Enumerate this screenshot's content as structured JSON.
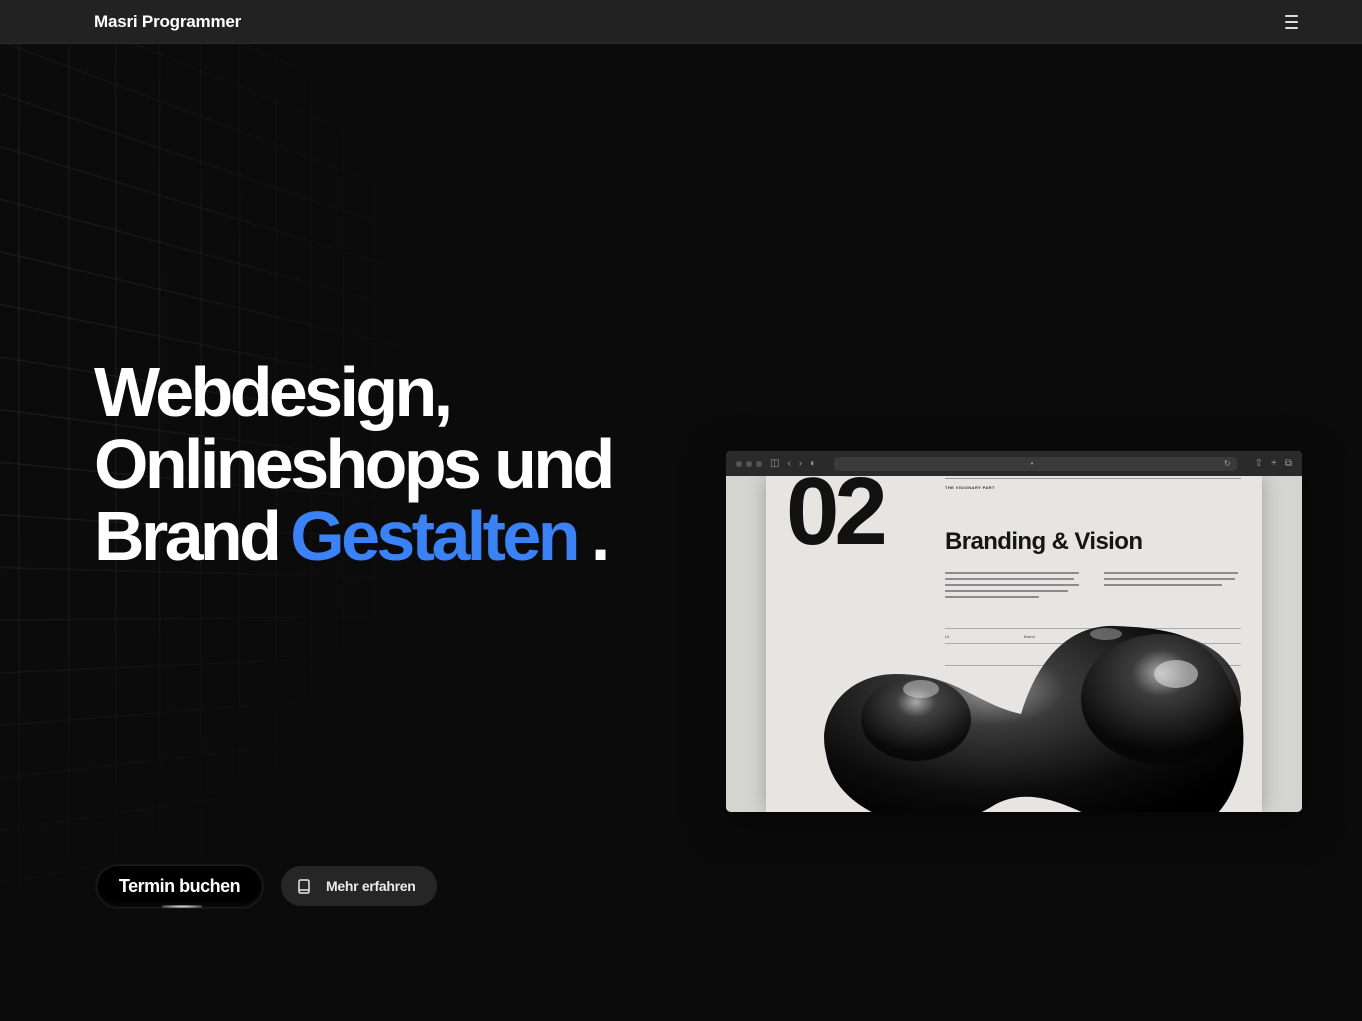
{
  "nav": {
    "brand": "Masri Programmer",
    "menu_icon": "hamburger-menu-icon"
  },
  "hero": {
    "line1": "Webdesign,",
    "line2": "Onlineshops und",
    "line3_plain": "Brand",
    "line3_accent": "Gestalten",
    "line3_end": ".",
    "accent_color": "#3b82f6"
  },
  "mockup": {
    "number": "02",
    "kicker": "THE VISIONARY PART",
    "title": "Branding & Vision",
    "row_label_1": "UI",
    "row_label_2": "Brand"
  },
  "buttons": {
    "primary_label": "Termin buchen",
    "secondary_label": "Mehr erfahren",
    "secondary_icon": "book-icon"
  }
}
